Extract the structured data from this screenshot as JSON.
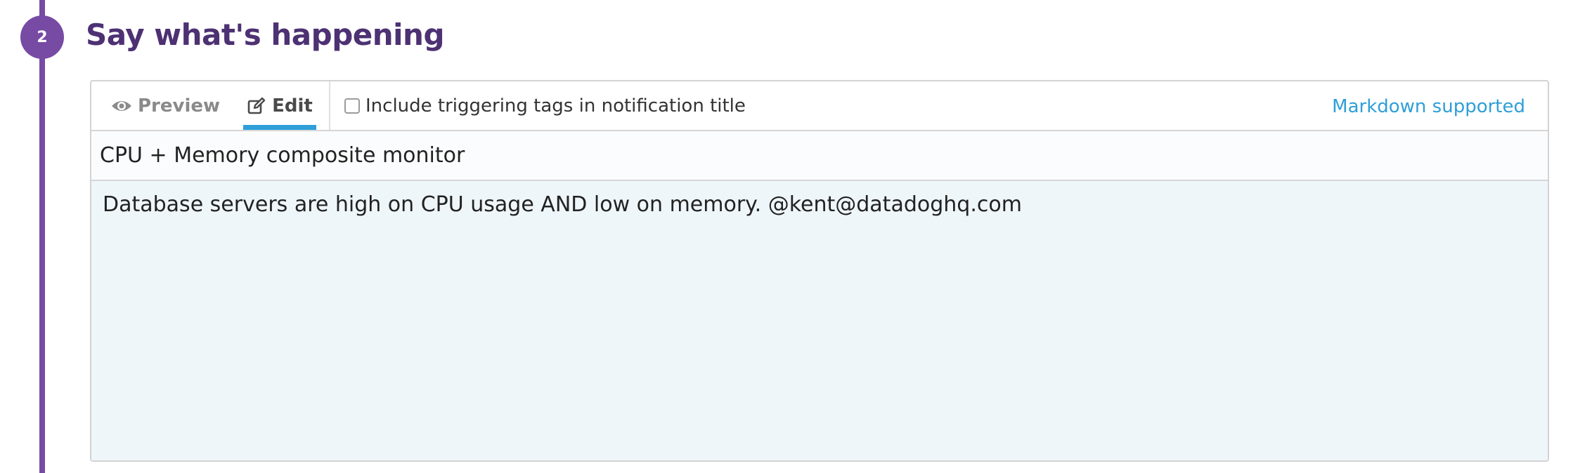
{
  "step": {
    "number": "2",
    "title": "Say what's happening"
  },
  "editor": {
    "tabs": [
      {
        "label": "Preview",
        "icon": "eye-icon",
        "active": false
      },
      {
        "label": "Edit",
        "icon": "edit-icon",
        "active": true
      }
    ],
    "include_tags_label": "Include triggering tags in notification title",
    "include_tags_checked": false,
    "markdown_link": "Markdown supported",
    "title_value": "CPU + Memory composite monitor",
    "body_value": "Database servers are high on CPU usage AND low on memory. @kent@datadoghq.com"
  },
  "colors": {
    "accent_purple": "#774aa4",
    "title_purple": "#4d3173",
    "link_blue": "#2e9fd8",
    "body_bg": "#eff6fa"
  }
}
